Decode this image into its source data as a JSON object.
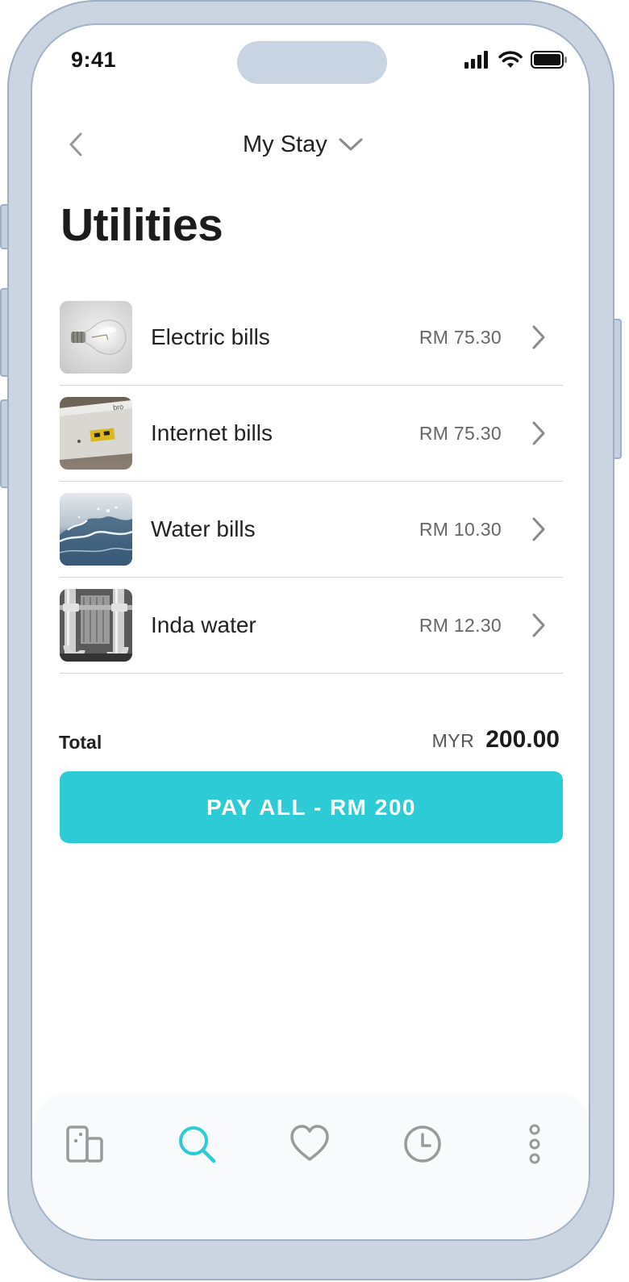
{
  "status_bar": {
    "time": "9:41"
  },
  "header": {
    "title": "My Stay"
  },
  "page_title": "Utilities",
  "utilities": [
    {
      "label": "Electric bills",
      "amount": "RM 75.30",
      "thumbnail": "light-bulb"
    },
    {
      "label": "Internet bills",
      "amount": "RM 75.30",
      "thumbnail": "router"
    },
    {
      "label": "Water bills",
      "amount": "RM 10.30",
      "thumbnail": "water-splash"
    },
    {
      "label": "Inda water",
      "amount": "RM 12.30",
      "thumbnail": "pipes"
    }
  ],
  "total": {
    "label": "Total",
    "currency": "MYR",
    "value": "200.00"
  },
  "pay_button": {
    "label": "PAY ALL - RM 200"
  },
  "bottom_nav": [
    {
      "icon": "building-icon",
      "active": false
    },
    {
      "icon": "search-icon",
      "active": true
    },
    {
      "icon": "heart-icon",
      "active": false
    },
    {
      "icon": "clock-icon",
      "active": false
    },
    {
      "icon": "more-icon",
      "active": false
    }
  ],
  "colors": {
    "accent": "#2ccbd5",
    "frame": "#cbd5e1",
    "text_primary": "#222222",
    "text_secondary": "#666666",
    "icon_inactive": "#9a9a9a"
  }
}
